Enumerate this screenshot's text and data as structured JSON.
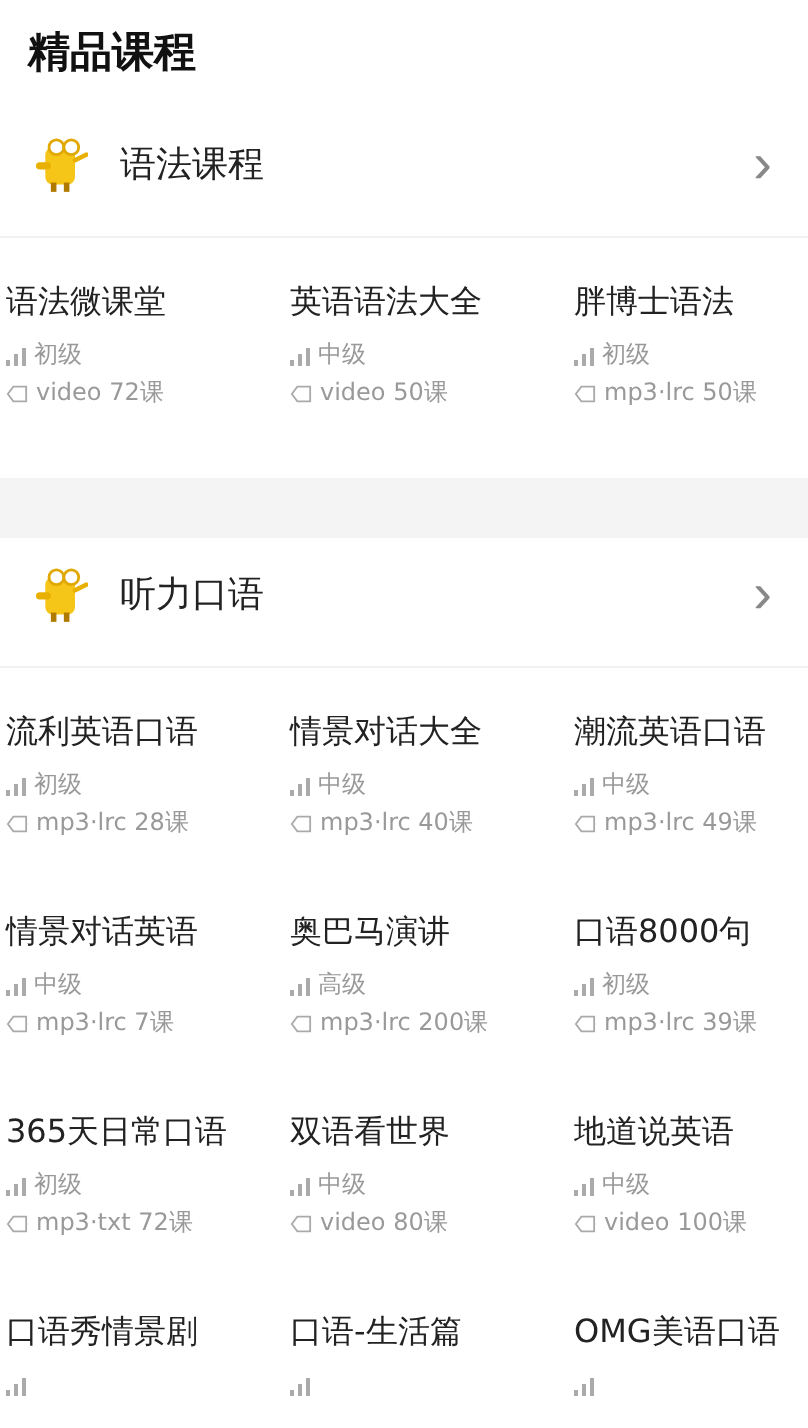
{
  "page_title": "精品课程",
  "sections": [
    {
      "title": "语法课程",
      "chevron": "›",
      "courses": [
        {
          "title": "语法微课堂",
          "level": "初级",
          "format": "video 72课"
        },
        {
          "title": "英语语法大全",
          "level": "中级",
          "format": "video 50课"
        },
        {
          "title": "胖博士语法",
          "level": "初级",
          "format": "mp3·lrc 50课"
        }
      ]
    },
    {
      "title": "听力口语",
      "chevron": "›",
      "courses": [
        {
          "title": "流利英语口语",
          "level": "初级",
          "format": "mp3·lrc 28课"
        },
        {
          "title": "情景对话大全",
          "level": "中级",
          "format": "mp3·lrc 40课"
        },
        {
          "title": "潮流英语口语",
          "level": "中级",
          "format": "mp3·lrc 49课"
        },
        {
          "title": "情景对话英语",
          "level": "中级",
          "format": "mp3·lrc 7课"
        },
        {
          "title": "奥巴马演讲",
          "level": "高级",
          "format": "mp3·lrc 200课"
        },
        {
          "title": "口语8000句",
          "level": "初级",
          "format": "mp3·lrc 39课"
        },
        {
          "title": "365天日常口语",
          "level": "初级",
          "format": "mp3·txt 72课"
        },
        {
          "title": "双语看世界",
          "level": "中级",
          "format": "video 80课"
        },
        {
          "title": "地道说英语",
          "level": "中级",
          "format": "video 100课"
        },
        {
          "title": "口语秀情景剧"
        },
        {
          "title": "口语-生活篇"
        },
        {
          "title": "OMG美语口语"
        }
      ]
    }
  ]
}
